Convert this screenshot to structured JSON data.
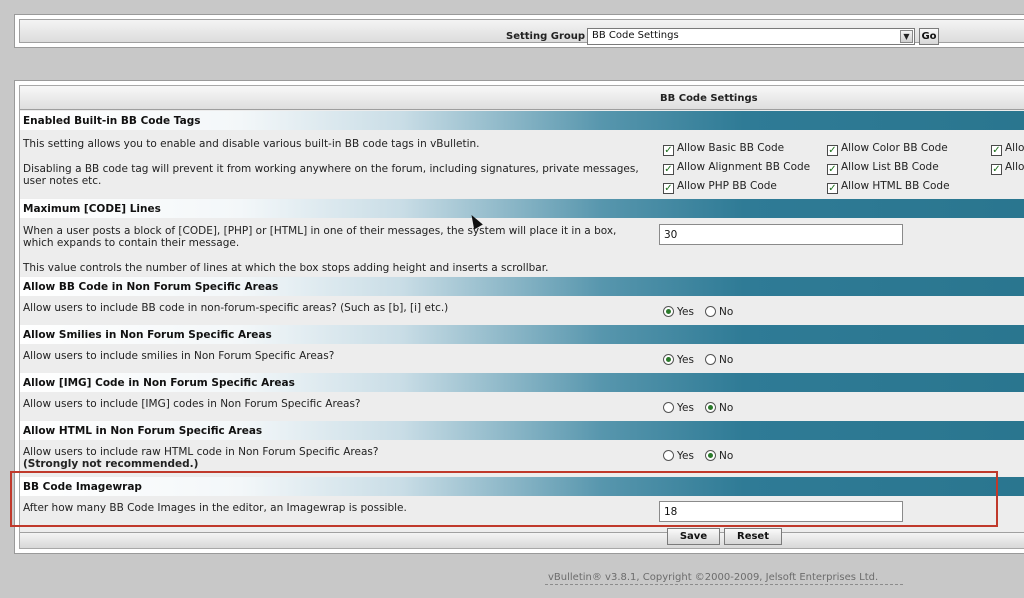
{
  "setting_group": {
    "label": "Setting Group",
    "selected": "BB Code Settings",
    "go_label": "Go"
  },
  "panel": {
    "title": "BB Code Settings"
  },
  "sections": {
    "enabled_tags": {
      "title": "Enabled Built-in BB Code Tags",
      "desc1": "This setting allows you to enable and disable various built-in BB code tags in vBulletin.",
      "desc2a": "Disabling a BB code tag will prevent it from working anywhere on the forum, including signatures, private messages,",
      "desc2b": "user notes etc.",
      "checkboxes": {
        "basic": "Allow Basic BB Code",
        "color": "Allow Color BB Code",
        "alignment": "Allow Alignment BB Code",
        "list": "Allow List BB Code",
        "php": "Allow PHP BB Code",
        "html": "Allow HTML BB Code",
        "col3_row1": "Allo",
        "col3_row2": "Allo"
      }
    },
    "max_code_lines": {
      "title": "Maximum [CODE] Lines",
      "desc1a": "When a user posts a block of [CODE], [PHP] or [HTML] in one of their messages, the system will place it in a box,",
      "desc1b": "which expands to contain their message.",
      "desc2": "This value controls the number of lines at which the box stops adding height and inserts a scrollbar.",
      "value": "30"
    },
    "bbcode_nonforum": {
      "title": "Allow BB Code in Non Forum Specific Areas",
      "desc": "Allow users to include BB code in non-forum-specific areas? (Such as [b], [i] etc.)",
      "selected": "yes"
    },
    "smilies_nonforum": {
      "title": "Allow Smilies in Non Forum Specific Areas",
      "desc": "Allow users to include smilies in Non Forum Specific Areas?",
      "selected": "yes"
    },
    "img_nonforum": {
      "title": "Allow [IMG] Code in Non Forum Specific Areas",
      "desc": "Allow users to include [IMG] codes in Non Forum Specific Areas?",
      "selected": "no"
    },
    "html_nonforum": {
      "title": "Allow HTML in Non Forum Specific Areas",
      "desc": "Allow users to include raw HTML code in Non Forum Specific Areas?",
      "warning": "(Strongly not recommended.)",
      "selected": "no"
    },
    "imagewrap": {
      "title": "BB Code Imagewrap",
      "desc": "After how many BB Code Images in the editor, an Imagewrap is possible.",
      "value": "18"
    }
  },
  "radio_labels": {
    "yes": "Yes",
    "no": "No"
  },
  "buttons": {
    "save": "Save",
    "reset": "Reset"
  },
  "copyright": "vBulletin® v3.8.1, Copyright ©2000-2009, Jelsoft Enterprises Ltd.",
  "colors": {
    "section_header_accent": "#2a768f",
    "highlight_border": "#c0392b"
  },
  "icons": {
    "checkbox_checked": "check-icon",
    "select_arrow": "chevron-down-icon"
  }
}
